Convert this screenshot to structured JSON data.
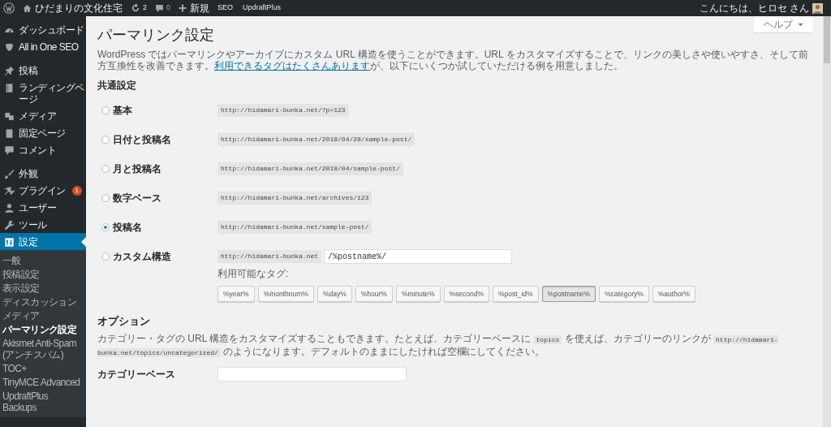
{
  "admin_bar": {
    "site_name": "ひだまりの文化住宅",
    "updates": "2",
    "comments": "0",
    "new_label": "新規",
    "links": [
      "SEO",
      "UpdraftPlus"
    ],
    "greeting": "こんにちは、ヒロセ さん"
  },
  "sidebar": {
    "groups": [
      [
        {
          "label": "ダッシュボード",
          "selected": false
        },
        {
          "label": "All in One SEO",
          "selected": false
        }
      ],
      [
        {
          "label": "投稿",
          "selected": false
        },
        {
          "label": "ランディングページ",
          "selected": false
        },
        {
          "label": "メディア",
          "selected": false
        },
        {
          "label": "固定ページ",
          "selected": false
        },
        {
          "label": "コメント",
          "selected": false
        }
      ],
      [
        {
          "label": "外観",
          "selected": false
        },
        {
          "label": "プラグイン",
          "badge": "1",
          "selected": false
        },
        {
          "label": "ユーザー",
          "selected": false
        },
        {
          "label": "ツール",
          "selected": false
        },
        {
          "label": "設定",
          "selected": true,
          "children": [
            {
              "label": "一般",
              "selected": false
            },
            {
              "label": "投稿設定",
              "selected": false
            },
            {
              "label": "表示設定",
              "selected": false
            },
            {
              "label": "ディスカッション",
              "selected": false
            },
            {
              "label": "メディア",
              "selected": false
            },
            {
              "label": "パーマリンク設定",
              "selected": true
            },
            {
              "label": "Akismet Anti-Spam (アンチスパム)",
              "selected": false
            },
            {
              "label": "TOC+",
              "selected": false
            },
            {
              "label": "TinyMCE Advanced",
              "selected": false
            },
            {
              "label": "UpdraftPlus Backups",
              "selected": false
            }
          ]
        }
      ]
    ]
  },
  "help_button": "ヘルプ",
  "title": "パーマリンク設定",
  "intro": {
    "text_before": "WordPress ではパーマリンクやアーカイブにカスタム URL 構造を使うことができます。URL をカスタマイズすることで、リンクの美しさや使いやすさ、そして前方互換性を改善できます。",
    "link": "利用できるタグはたくさんあります",
    "text_after": "が、以下にいくつか試していただける例を用意しました。"
  },
  "common_settings": {
    "heading": "共通設定",
    "options": [
      {
        "kind": "preset",
        "label": "基本",
        "url": "http://hidamari-bunka.net/?p=123",
        "selected": false
      },
      {
        "kind": "preset",
        "label": "日付と投稿名",
        "url": "http://hidamari-bunka.net/2018/04/28/sample-post/",
        "selected": false
      },
      {
        "kind": "preset",
        "label": "月と投稿名",
        "url": "http://hidamari-bunka.net/2018/04/sample-post/",
        "selected": false
      },
      {
        "kind": "preset",
        "label": "数字ベース",
        "url": "http://hidamari-bunka.net/archives/123",
        "selected": false
      },
      {
        "kind": "preset",
        "label": "投稿名",
        "url": "http://hidamari-bunka.net/sample-post/",
        "selected": true
      },
      {
        "kind": "custom",
        "label": "カスタム構造",
        "prefix": "http://hidamari-bunka.net",
        "value": "/%postname%/",
        "tags_label": "利用可能なタグ:",
        "selected": false,
        "tags": [
          {
            "label": "%year%",
            "selected": false
          },
          {
            "label": "%monthnum%",
            "selected": false
          },
          {
            "label": "%day%",
            "selected": false
          },
          {
            "label": "%hour%",
            "selected": false
          },
          {
            "label": "%minute%",
            "selected": false
          },
          {
            "label": "%second%",
            "selected": false
          },
          {
            "label": "%post_id%",
            "selected": false
          },
          {
            "label": "%postname%",
            "selected": true
          },
          {
            "label": "%category%",
            "selected": false
          },
          {
            "label": "%author%",
            "selected": false
          }
        ]
      }
    ]
  },
  "options": {
    "heading": "オプション",
    "description": [
      {
        "kind": "text",
        "text": "カテゴリー・タグの URL 構造をカスタマイズすることもできます。たとえば、カテゴリーベースに "
      },
      {
        "kind": "code",
        "text": "topics"
      },
      {
        "kind": "text",
        "text": " を使えば、カテゴリーのリンクが "
      },
      {
        "kind": "code",
        "text": "http://hidamari-bunka.net/topics/uncategorized/"
      },
      {
        "kind": "text",
        "text": " のようになります。デフォルトのままにしたければ空欄にしてください。"
      }
    ],
    "fields": [
      {
        "label": "カテゴリーベース"
      }
    ]
  }
}
